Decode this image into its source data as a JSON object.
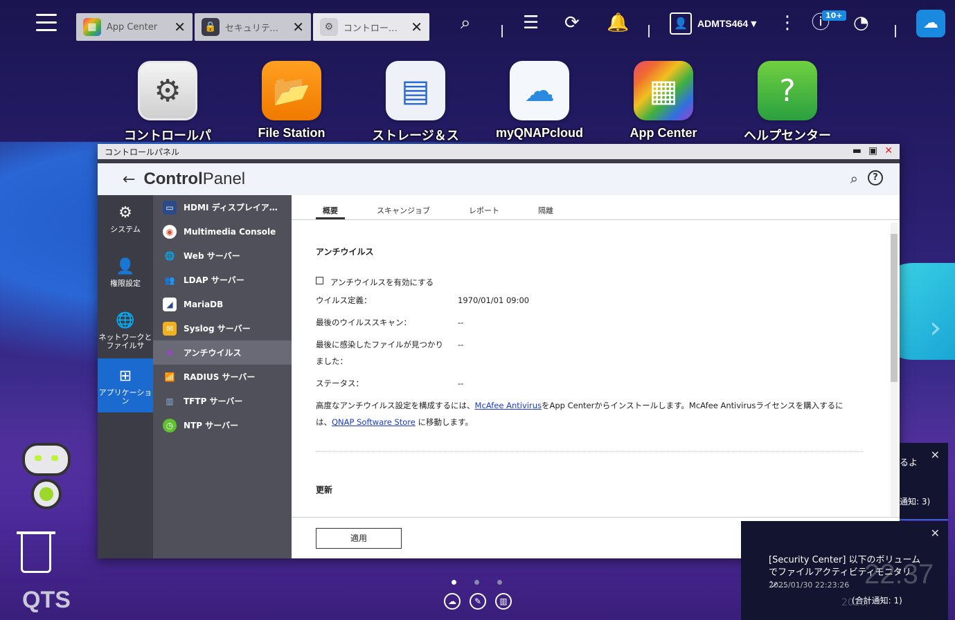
{
  "taskbar": {
    "tabs": [
      {
        "label": "App Center",
        "icon": "app-center-icon"
      },
      {
        "label": "セキュリティ…",
        "icon": "security-icon"
      },
      {
        "label": "コントロール…",
        "icon": "control-panel-icon"
      }
    ],
    "username": "ADMTS464",
    "notification_badge": "10+"
  },
  "desktop": {
    "apps": [
      {
        "label": "コントロールパ"
      },
      {
        "label": "File Station"
      },
      {
        "label": "ストレージ＆ス"
      },
      {
        "label": "myQNAPcloud"
      },
      {
        "label": "App Center"
      },
      {
        "label": "ヘルプセンター"
      }
    ],
    "brand": "QTS",
    "clock": "22:37",
    "date_partial": "2025/"
  },
  "window": {
    "title": "コントロールパネル",
    "brand_bold": "Control",
    "brand_rest": "Panel",
    "categories": [
      {
        "label": "システム"
      },
      {
        "label": "権限設定"
      },
      {
        "label": "ネットワークとファイルサ"
      },
      {
        "label": "アプリケーション"
      }
    ],
    "sub_items": [
      {
        "label": "HDMI ディスプレイアプ…"
      },
      {
        "label": "Multimedia Console"
      },
      {
        "label": "Web サーバー"
      },
      {
        "label": "LDAP サーバー"
      },
      {
        "label": "MariaDB"
      },
      {
        "label": "Syslog サーバー"
      },
      {
        "label": "アンチウイルス"
      },
      {
        "label": "RADIUS サーバー"
      },
      {
        "label": "TFTP サーバー"
      },
      {
        "label": "NTP サーバー"
      }
    ],
    "tabs": [
      {
        "label": "概要"
      },
      {
        "label": "スキャンジョブ"
      },
      {
        "label": "レポート"
      },
      {
        "label": "隔離"
      }
    ],
    "antivirus": {
      "section_title": "アンチウイルス",
      "enable_label": "アンチウイルスを有効にする",
      "virus_def_label": "ウイルス定義：",
      "virus_def_value": "1970/01/01 09:00",
      "last_scan_label": "最後のウイルススキャン：",
      "last_scan_value": "--",
      "last_infected_label": "最後に感染したファイルが見つかりました：",
      "last_infected_value": "--",
      "status_label": "ステータス：",
      "status_value": "--",
      "note_pre": "高度なアンチウイルス設定を構成するには、",
      "note_link1": "McAfee Antivirus",
      "note_mid": "をApp Centerからインストールします。McAfee Antivirusライセンスを購入するには、",
      "note_link2": "QNAP Software Store",
      "note_post": " に移動します。"
    },
    "update_title": "更新",
    "apply_label": "適用"
  },
  "notifications": [
    {
      "text_partial": "るよ",
      "count_partial": "通知: 3)"
    },
    {
      "title": "[Security Center] 以下のボリュームでファイルアクティビティモニタリン…",
      "time": "2025/01/30 22:23:26",
      "count": "(合計通知: 1)"
    }
  ]
}
